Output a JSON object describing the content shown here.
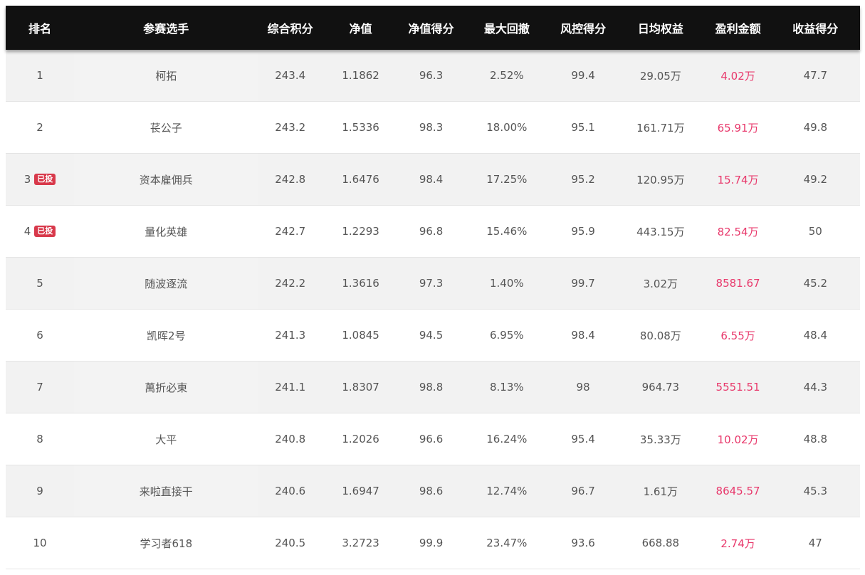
{
  "headers": {
    "rank": "排名",
    "player": "参赛选手",
    "total_score": "综合积分",
    "nav": "净值",
    "nav_score": "净值得分",
    "max_drawdown": "最大回撤",
    "risk_score": "风控得分",
    "daily_equity": "日均权益",
    "profit": "盈利金额",
    "return_score": "收益得分"
  },
  "colors": {
    "header_bg": "#111111",
    "profit_text": "#e8386b",
    "badge_bg": "#d8394b"
  },
  "rows": [
    {
      "rank": "1",
      "badge": "",
      "player": "柯拓",
      "total_score": "243.4",
      "nav": "1.1862",
      "nav_score": "96.3",
      "max_drawdown": "2.52%",
      "risk_score": "99.4",
      "daily_equity": "29.05万",
      "profit": "4.02万",
      "return_score": "47.7"
    },
    {
      "rank": "2",
      "badge": "",
      "player": "苌公子",
      "total_score": "243.2",
      "nav": "1.5336",
      "nav_score": "98.3",
      "max_drawdown": "18.00%",
      "risk_score": "95.1",
      "daily_equity": "161.71万",
      "profit": "65.91万",
      "return_score": "49.8"
    },
    {
      "rank": "3",
      "badge": "已投",
      "player": "资本雇佣兵",
      "total_score": "242.8",
      "nav": "1.6476",
      "nav_score": "98.4",
      "max_drawdown": "17.25%",
      "risk_score": "95.2",
      "daily_equity": "120.95万",
      "profit": "15.74万",
      "return_score": "49.2"
    },
    {
      "rank": "4",
      "badge": "已投",
      "player": "量化英雄",
      "total_score": "242.7",
      "nav": "1.2293",
      "nav_score": "96.8",
      "max_drawdown": "15.46%",
      "risk_score": "95.9",
      "daily_equity": "443.15万",
      "profit": "82.54万",
      "return_score": "50"
    },
    {
      "rank": "5",
      "badge": "",
      "player": "随波逐流",
      "total_score": "242.2",
      "nav": "1.3616",
      "nav_score": "97.3",
      "max_drawdown": "1.40%",
      "risk_score": "99.7",
      "daily_equity": "3.02万",
      "profit": "8581.67",
      "return_score": "45.2"
    },
    {
      "rank": "6",
      "badge": "",
      "player": "凯晖2号",
      "total_score": "241.3",
      "nav": "1.0845",
      "nav_score": "94.5",
      "max_drawdown": "6.95%",
      "risk_score": "98.4",
      "daily_equity": "80.08万",
      "profit": "6.55万",
      "return_score": "48.4"
    },
    {
      "rank": "7",
      "badge": "",
      "player": "萬折必東",
      "total_score": "241.1",
      "nav": "1.8307",
      "nav_score": "98.8",
      "max_drawdown": "8.13%",
      "risk_score": "98",
      "daily_equity": "964.73",
      "profit": "5551.51",
      "return_score": "44.3"
    },
    {
      "rank": "8",
      "badge": "",
      "player": "大平",
      "total_score": "240.8",
      "nav": "1.2026",
      "nav_score": "96.6",
      "max_drawdown": "16.24%",
      "risk_score": "95.4",
      "daily_equity": "35.33万",
      "profit": "10.02万",
      "return_score": "48.8"
    },
    {
      "rank": "9",
      "badge": "",
      "player": "来啦直接干",
      "total_score": "240.6",
      "nav": "1.6947",
      "nav_score": "98.6",
      "max_drawdown": "12.74%",
      "risk_score": "96.7",
      "daily_equity": "1.61万",
      "profit": "8645.57",
      "return_score": "45.3"
    },
    {
      "rank": "10",
      "badge": "",
      "player": "学习者618",
      "total_score": "240.5",
      "nav": "3.2723",
      "nav_score": "99.9",
      "max_drawdown": "23.47%",
      "risk_score": "93.6",
      "daily_equity": "668.88",
      "profit": "2.74万",
      "return_score": "47"
    }
  ]
}
